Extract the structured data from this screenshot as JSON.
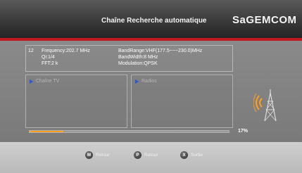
{
  "header": {
    "title": "Chaîne Recherche automatique",
    "brand": "SaGEMCOM"
  },
  "info": {
    "channel_num": "12",
    "frequency": "Frequency:202.7 MHz",
    "qi": "Qi:1/4",
    "fft": "FFT:2 k",
    "band_range": "BandRange:VHF(177.5~~~230.0)MHz",
    "bandwidth": "BandWidth:8 MHz",
    "modulation": "Modulation:QPSK"
  },
  "lists": {
    "tv_label": "Chaîne TV",
    "radio_label": "Radios"
  },
  "progress": {
    "value": 0.17,
    "label": "17%"
  },
  "footer": {
    "buttons": [
      {
        "key": "M",
        "label": "Retour"
      },
      {
        "key": "P",
        "label": "Retour"
      },
      {
        "key": "X",
        "label": "Sortie"
      }
    ]
  },
  "colors": {
    "accent": "#c01820",
    "progress": "#ff9f20",
    "arrow": "#2e58c8"
  }
}
